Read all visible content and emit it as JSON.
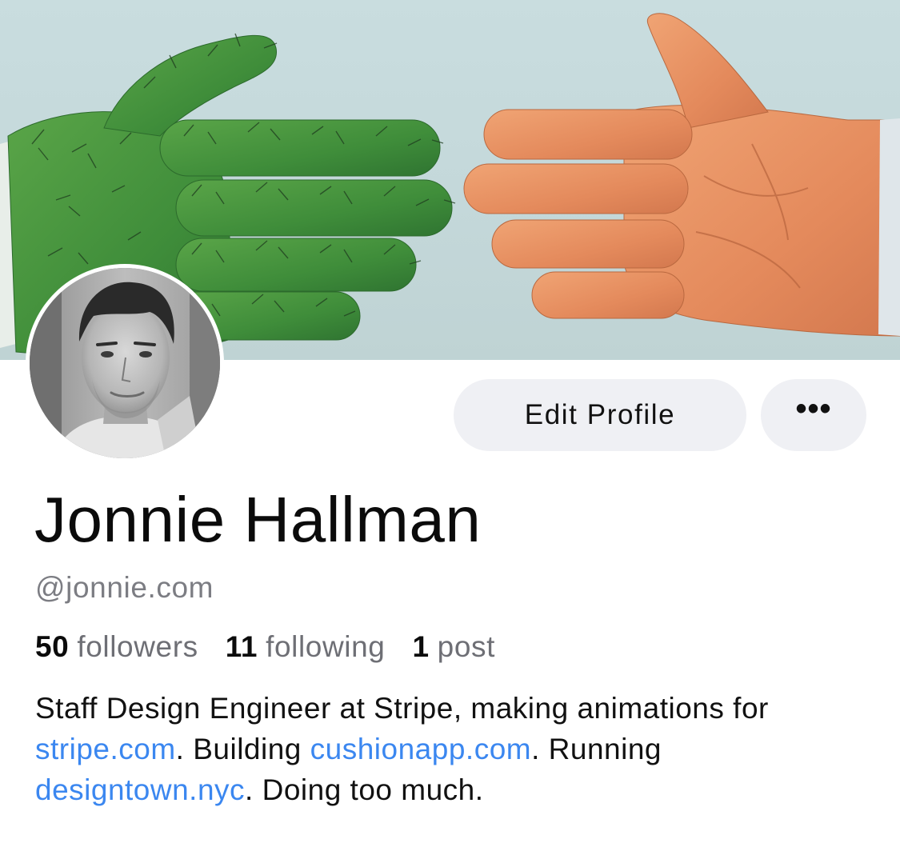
{
  "banner": {
    "description_icon": "banner-illustration"
  },
  "profile": {
    "name": "Jonnie Hallman",
    "handle": "@jonnie.com",
    "avatar_icon": "avatar-photo"
  },
  "actions": {
    "edit_profile_label": "Edit Profile",
    "more_label": "•••"
  },
  "stats": [
    {
      "count": "50",
      "label": "followers"
    },
    {
      "count": "11",
      "label": "following"
    },
    {
      "count": "1",
      "label": "post"
    }
  ],
  "bio": {
    "part1": "Staff Design Engineer at Stripe, making animations for ",
    "link1": "stripe.com",
    "part2": ". Building ",
    "link2": "cushionapp.com",
    "part3": ". Running ",
    "link3": "designtown.nyc",
    "part4": ". Doing too much."
  },
  "colors": {
    "link": "#3b87f0",
    "button_bg": "#eff0f4",
    "secondary_text": "#7c7d83"
  }
}
